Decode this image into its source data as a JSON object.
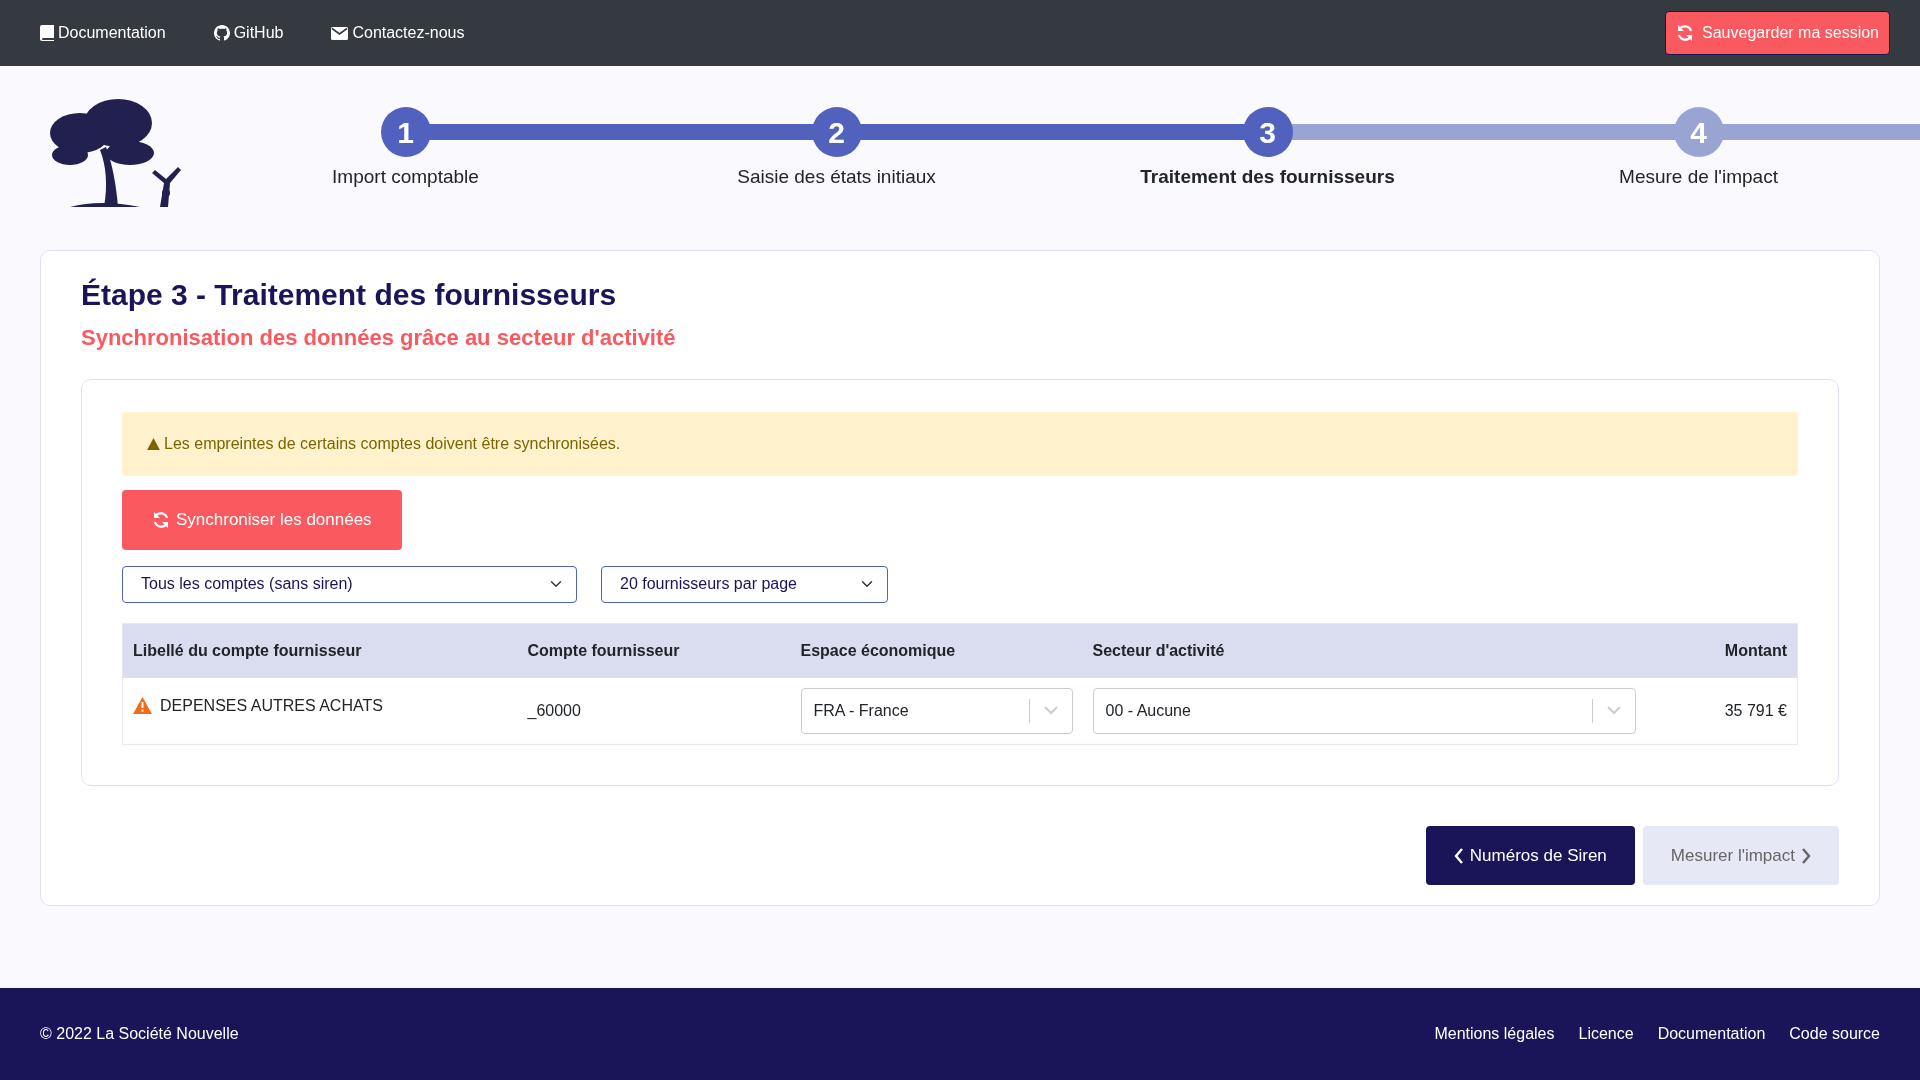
{
  "topbar": {
    "links": [
      {
        "kind": "book",
        "label": "Documentation"
      },
      {
        "kind": "github",
        "label": "GitHub"
      },
      {
        "kind": "mail",
        "label": "Contactez-nous"
      }
    ],
    "save_button": "Sauvegarder ma session"
  },
  "steps": [
    {
      "number": "1",
      "label": "Import comptable",
      "done": true,
      "selected": false
    },
    {
      "number": "2",
      "label": "Saisie des états initiaux",
      "done": true,
      "selected": false
    },
    {
      "number": "3",
      "label": "Traitement des fournisseurs",
      "done": false,
      "selected": true
    },
    {
      "number": "4",
      "label": "Mesure de l'impact",
      "done": false,
      "selected": false
    }
  ],
  "title": "Étape 3 - Traitement des fournisseurs",
  "subtitle": "Synchronisation des données grâce au secteur d'activité",
  "alert": "Les empreintes de certains comptes doivent être synchronisées.",
  "sync_button": "Synchroniser les données",
  "filters": [
    {
      "value": "Tous les comptes (sans siren)"
    },
    {
      "value": "20 fournisseurs par page"
    }
  ],
  "table": {
    "columns": [
      "Libellé du compte fournisseur",
      "Compte fournisseur",
      "Espace économique",
      "Secteur d'activité",
      "Montant"
    ],
    "rows": [
      {
        "warning": true,
        "label": "DEPENSES AUTRES ACHATS",
        "account": "_60000",
        "area": "FRA - France",
        "sector": "00 - Aucune",
        "amount": "35 791 €"
      }
    ]
  },
  "nav_buttons": [
    {
      "kind": "prev",
      "label": "Numéros de Siren",
      "disabled": false
    },
    {
      "kind": "next",
      "label": "Mesurer l'impact",
      "disabled": true
    }
  ],
  "footer": {
    "copyright": "© 2022 La Société Nouvelle",
    "links": [
      "Mentions légales",
      "Licence",
      "Documentation",
      "Code source"
    ]
  }
}
